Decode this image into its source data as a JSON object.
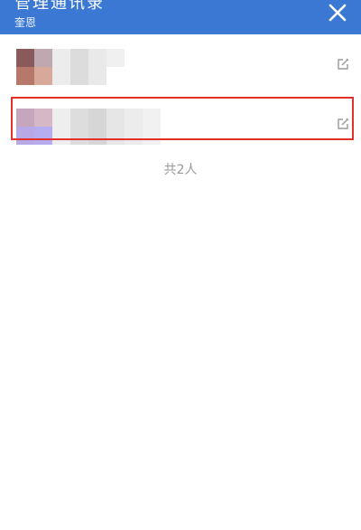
{
  "header": {
    "title": "管理通讯录",
    "subtitle": "奎恩",
    "close_icon": "close-icon",
    "background_color": "#3a78d4"
  },
  "contacts": [
    {
      "name_visible": false,
      "avatar_pixels": [
        "#8a5a5a",
        "#c0a8b0",
        "#b5786a",
        "#d7a99b"
      ],
      "edit_icon": "edit-icon"
    },
    {
      "name_visible": false,
      "avatar_pixels": [
        "#c6a6bd",
        "#d6b7c6",
        "#b9a8e6",
        "#b6acf0"
      ],
      "edit_icon": "edit-icon",
      "highlighted": true
    }
  ],
  "footer": {
    "count_label": "共2人"
  },
  "colors": {
    "highlight_border": "#e0312b",
    "muted_text": "#999999"
  }
}
